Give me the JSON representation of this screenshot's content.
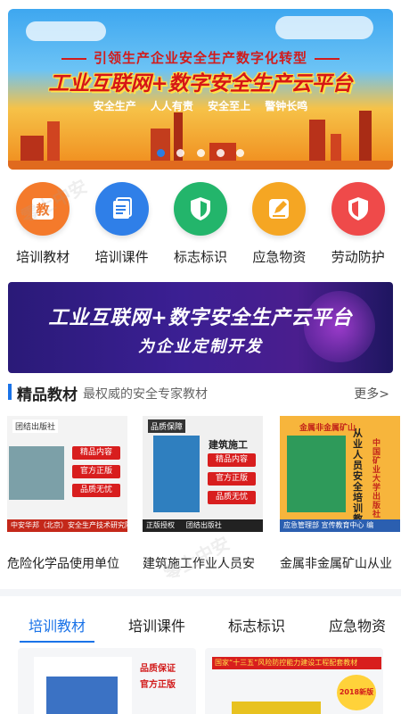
{
  "hero": {
    "kicker": "引领生产企业安全生产数字化转型",
    "headline": "工业互联网+数字安全生产云平台",
    "slogans": [
      "安全生产",
      "人人有责",
      "安全至上",
      "警钟长鸣"
    ],
    "slide_count": 5,
    "active_slide": 1
  },
  "categories": [
    {
      "label": "培训教材",
      "icon": "book-icon",
      "color": "#f47a2b",
      "glyph": "教"
    },
    {
      "label": "培训课件",
      "icon": "document-icon",
      "color": "#2f7fe8"
    },
    {
      "label": "标志标识",
      "icon": "shield-check-icon",
      "color": "#23b56b"
    },
    {
      "label": "应急物资",
      "icon": "edit-icon",
      "color": "#f5a623"
    },
    {
      "label": "劳动防护",
      "icon": "shield-icon",
      "color": "#ef4a4a"
    }
  ],
  "promo": {
    "line1": "工业互联网+数字安全生产云平台",
    "line2": "为企业定制开发"
  },
  "section": {
    "title": "精品教材",
    "subtitle": "最权威的安全专家教材",
    "more": "更多>"
  },
  "books": [
    {
      "name": "危险化学品使用单位",
      "cover_top": "团结出版社",
      "tags": [
        "精品内容",
        "官方正版",
        "品质无忧"
      ],
      "strip": "中安华邦（北京）安全生产技术研究院 编"
    },
    {
      "name": "建筑施工作业人员安",
      "cover_top": "品质保障",
      "cover_title": "建筑施工",
      "tags": [
        "精品内容",
        "官方正版",
        "品质无忧"
      ],
      "strip_left": "正版授权",
      "strip": "团结出版社"
    },
    {
      "name": "金属非金属矿山从业",
      "cover_top": "金属非金属矿山",
      "vertical": "从业人员安全培训教材",
      "publisher": "中国矿业大学出版社",
      "strip": "应急管理部  宣传教育中心 编"
    }
  ],
  "tabs": [
    "培训教材",
    "培训课件",
    "标志标识",
    "应急物资"
  ],
  "active_tab": 0,
  "bottom_cards": [
    {
      "tags": [
        "品质保证",
        "官方正版"
      ]
    },
    {
      "banner": "国家“十三五”风险防控能力建设工程配套教材",
      "badge": "2018新版"
    }
  ],
  "watermarks": [
    "零上中安",
    "零上中安"
  ]
}
